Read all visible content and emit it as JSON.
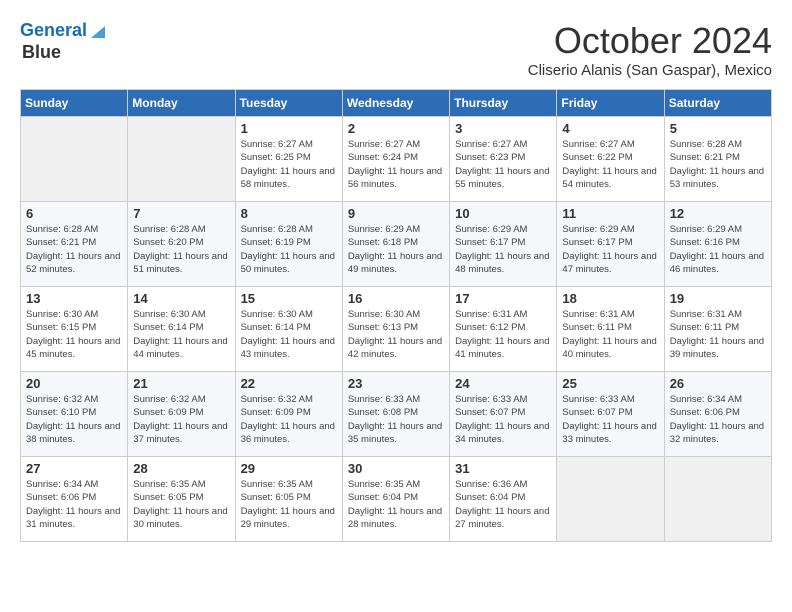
{
  "header": {
    "logo_line1": "General",
    "logo_line2": "Blue",
    "month": "October 2024",
    "location": "Cliserio Alanis (San Gaspar), Mexico"
  },
  "weekdays": [
    "Sunday",
    "Monday",
    "Tuesday",
    "Wednesday",
    "Thursday",
    "Friday",
    "Saturday"
  ],
  "weeks": [
    [
      {
        "day": "",
        "info": ""
      },
      {
        "day": "",
        "info": ""
      },
      {
        "day": "1",
        "info": "Sunrise: 6:27 AM\nSunset: 6:25 PM\nDaylight: 11 hours and 58 minutes."
      },
      {
        "day": "2",
        "info": "Sunrise: 6:27 AM\nSunset: 6:24 PM\nDaylight: 11 hours and 56 minutes."
      },
      {
        "day": "3",
        "info": "Sunrise: 6:27 AM\nSunset: 6:23 PM\nDaylight: 11 hours and 55 minutes."
      },
      {
        "day": "4",
        "info": "Sunrise: 6:27 AM\nSunset: 6:22 PM\nDaylight: 11 hours and 54 minutes."
      },
      {
        "day": "5",
        "info": "Sunrise: 6:28 AM\nSunset: 6:21 PM\nDaylight: 11 hours and 53 minutes."
      }
    ],
    [
      {
        "day": "6",
        "info": "Sunrise: 6:28 AM\nSunset: 6:21 PM\nDaylight: 11 hours and 52 minutes."
      },
      {
        "day": "7",
        "info": "Sunrise: 6:28 AM\nSunset: 6:20 PM\nDaylight: 11 hours and 51 minutes."
      },
      {
        "day": "8",
        "info": "Sunrise: 6:28 AM\nSunset: 6:19 PM\nDaylight: 11 hours and 50 minutes."
      },
      {
        "day": "9",
        "info": "Sunrise: 6:29 AM\nSunset: 6:18 PM\nDaylight: 11 hours and 49 minutes."
      },
      {
        "day": "10",
        "info": "Sunrise: 6:29 AM\nSunset: 6:17 PM\nDaylight: 11 hours and 48 minutes."
      },
      {
        "day": "11",
        "info": "Sunrise: 6:29 AM\nSunset: 6:17 PM\nDaylight: 11 hours and 47 minutes."
      },
      {
        "day": "12",
        "info": "Sunrise: 6:29 AM\nSunset: 6:16 PM\nDaylight: 11 hours and 46 minutes."
      }
    ],
    [
      {
        "day": "13",
        "info": "Sunrise: 6:30 AM\nSunset: 6:15 PM\nDaylight: 11 hours and 45 minutes."
      },
      {
        "day": "14",
        "info": "Sunrise: 6:30 AM\nSunset: 6:14 PM\nDaylight: 11 hours and 44 minutes."
      },
      {
        "day": "15",
        "info": "Sunrise: 6:30 AM\nSunset: 6:14 PM\nDaylight: 11 hours and 43 minutes."
      },
      {
        "day": "16",
        "info": "Sunrise: 6:30 AM\nSunset: 6:13 PM\nDaylight: 11 hours and 42 minutes."
      },
      {
        "day": "17",
        "info": "Sunrise: 6:31 AM\nSunset: 6:12 PM\nDaylight: 11 hours and 41 minutes."
      },
      {
        "day": "18",
        "info": "Sunrise: 6:31 AM\nSunset: 6:11 PM\nDaylight: 11 hours and 40 minutes."
      },
      {
        "day": "19",
        "info": "Sunrise: 6:31 AM\nSunset: 6:11 PM\nDaylight: 11 hours and 39 minutes."
      }
    ],
    [
      {
        "day": "20",
        "info": "Sunrise: 6:32 AM\nSunset: 6:10 PM\nDaylight: 11 hours and 38 minutes."
      },
      {
        "day": "21",
        "info": "Sunrise: 6:32 AM\nSunset: 6:09 PM\nDaylight: 11 hours and 37 minutes."
      },
      {
        "day": "22",
        "info": "Sunrise: 6:32 AM\nSunset: 6:09 PM\nDaylight: 11 hours and 36 minutes."
      },
      {
        "day": "23",
        "info": "Sunrise: 6:33 AM\nSunset: 6:08 PM\nDaylight: 11 hours and 35 minutes."
      },
      {
        "day": "24",
        "info": "Sunrise: 6:33 AM\nSunset: 6:07 PM\nDaylight: 11 hours and 34 minutes."
      },
      {
        "day": "25",
        "info": "Sunrise: 6:33 AM\nSunset: 6:07 PM\nDaylight: 11 hours and 33 minutes."
      },
      {
        "day": "26",
        "info": "Sunrise: 6:34 AM\nSunset: 6:06 PM\nDaylight: 11 hours and 32 minutes."
      }
    ],
    [
      {
        "day": "27",
        "info": "Sunrise: 6:34 AM\nSunset: 6:06 PM\nDaylight: 11 hours and 31 minutes."
      },
      {
        "day": "28",
        "info": "Sunrise: 6:35 AM\nSunset: 6:05 PM\nDaylight: 11 hours and 30 minutes."
      },
      {
        "day": "29",
        "info": "Sunrise: 6:35 AM\nSunset: 6:05 PM\nDaylight: 11 hours and 29 minutes."
      },
      {
        "day": "30",
        "info": "Sunrise: 6:35 AM\nSunset: 6:04 PM\nDaylight: 11 hours and 28 minutes."
      },
      {
        "day": "31",
        "info": "Sunrise: 6:36 AM\nSunset: 6:04 PM\nDaylight: 11 hours and 27 minutes."
      },
      {
        "day": "",
        "info": ""
      },
      {
        "day": "",
        "info": ""
      }
    ]
  ]
}
